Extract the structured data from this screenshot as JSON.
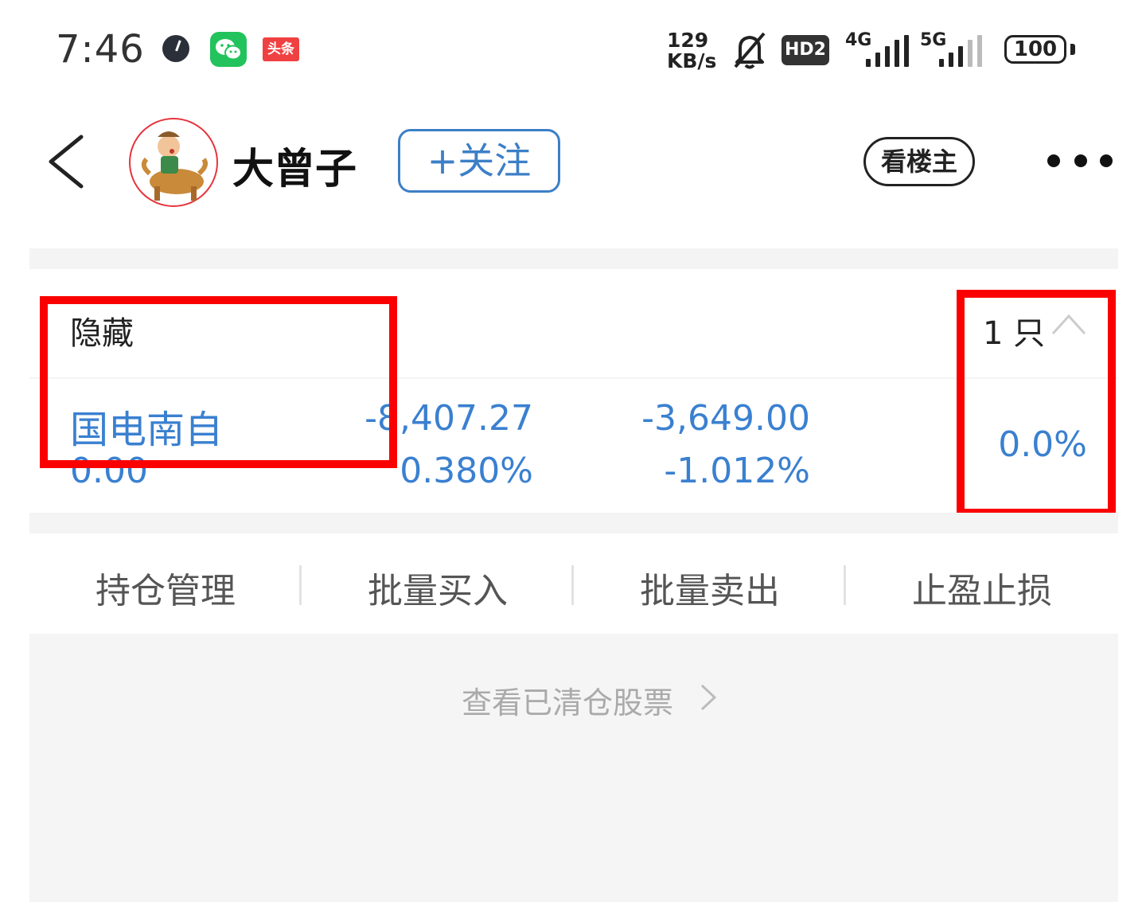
{
  "status_bar": {
    "time": "7:46",
    "toutiao_label": "头条",
    "net_speed_value": "129",
    "net_speed_unit": "KB/s",
    "hd_label": "HD2",
    "sim1_type": "4G",
    "sim2_type": "5G",
    "battery": "100"
  },
  "header": {
    "username": "大曾子",
    "follow_label": "+关注",
    "op_only_label": "看楼主"
  },
  "holdings": {
    "hide_label": "隐藏",
    "count_label": "1 只",
    "row": {
      "name": "国电南自",
      "sub_value": "0.00",
      "col2_top": "-8,407.27",
      "col2_bottom": "0.380%",
      "col3_top": "-3,649.00",
      "col3_bottom": "-1.012%",
      "col4": "0.0%"
    }
  },
  "actions": [
    "持仓管理",
    "批量买入",
    "批量卖出",
    "止盈止损"
  ],
  "cleared_link": "查看已清仓股票",
  "colors": {
    "accent_blue": "#3a80d0",
    "highlight_red": "#fa0000"
  }
}
